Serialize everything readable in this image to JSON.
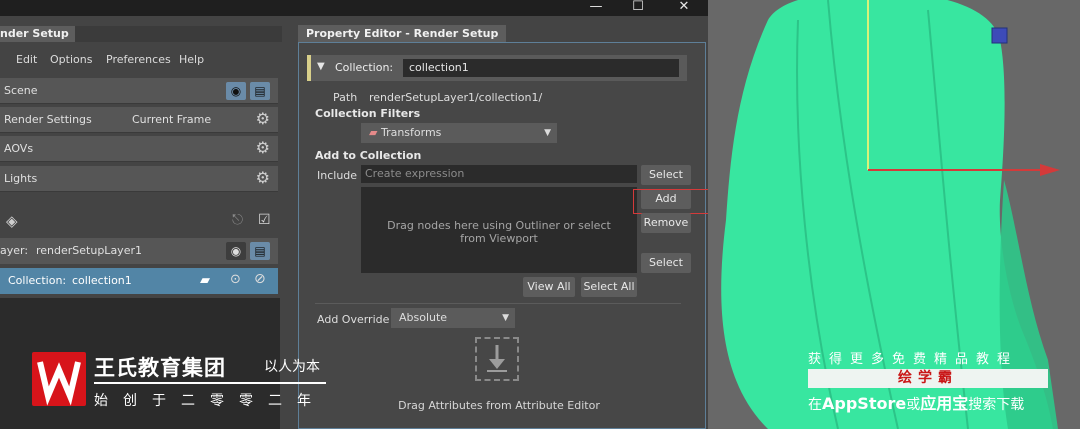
{
  "render_setup": {
    "tab_title": "nder Setup",
    "menu": [
      "Edit",
      "Options",
      "Preferences",
      "Help"
    ],
    "scene_label": "Scene",
    "render_settings_label": "Render Settings",
    "current_frame_label": "Current Frame",
    "aovs_label": "AOVs",
    "lights_label": "Lights",
    "layer_prefix": "ayer:",
    "layer_name": "renderSetupLayer1",
    "collection_prefix": "Collection:",
    "collection_name": "collection1"
  },
  "property_editor": {
    "tab_title": "Property Editor - Render Setup",
    "collection_label": "Collection:",
    "collection_value": "collection1",
    "path_label": "Path",
    "path_value": "renderSetupLayer1/collection1/",
    "collection_filters_label": "Collection Filters",
    "filter_value": "Transforms",
    "add_to_collection_label": "Add to Collection",
    "include_label": "Include",
    "include_placeholder": "Create expression",
    "select_button": "Select",
    "add_button": "Add",
    "remove_button": "Remove",
    "select_button_2": "Select",
    "drop_hint": "Drag nodes here using Outliner or select from Viewport",
    "view_all_button": "View All",
    "select_all_button": "Select All",
    "add_override_label": "Add Override",
    "override_value": "Absolute",
    "drag_attr_hint": "Drag Attributes from Attribute Editor"
  },
  "watermark": {
    "org_name": "王氏教育集团",
    "motto": "以人为本",
    "founded": "始创于二零零二年",
    "promo": "获得更多免费精品教程",
    "brand": "绘学霸",
    "search_pre": "在",
    "search_app": "AppStore",
    "search_mid": "或",
    "search_bold": "应用宝",
    "search_post": "搜索下载"
  },
  "colors": {
    "selected_row": "#5285a6",
    "hair_green": "#38e6a0",
    "highlight_red": "#d43a3a",
    "header_accent": "#d8cf8a",
    "logo_red": "#d7141a"
  }
}
